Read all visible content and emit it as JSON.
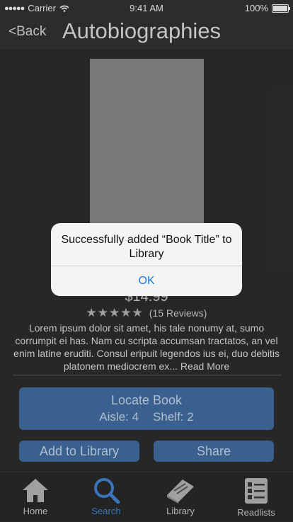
{
  "status_bar": {
    "carrier": "Carrier",
    "time": "9:41 AM",
    "battery": "100%"
  },
  "nav": {
    "back_label": "<Back",
    "title": "Autobiographies"
  },
  "book": {
    "price": "$14.99",
    "stars": "★★★★★",
    "reviews": "(15 Reviews)",
    "description": "Lorem ipsum dolor sit amet, his tale nonumy at, sumo corrumpit ei has. Nam cu scripta accumsan tractatos, an vel enim latine eruditi. Consul eripuit legendos ius ei, duo debitis platonem mediocrem ex... Read More"
  },
  "actions": {
    "locate_label": "Locate Book",
    "aisle": "Aisle: 4",
    "shelf": "Shelf: 2",
    "add_label": "Add to Library",
    "share_label": "Share"
  },
  "alert": {
    "message": "Successfully added “Book Title” to Library",
    "ok_label": "OK"
  },
  "tabs": [
    {
      "label": "Home",
      "icon": "home-icon"
    },
    {
      "label": "Search",
      "icon": "search-icon",
      "active": true
    },
    {
      "label": "Library",
      "icon": "book-icon"
    },
    {
      "label": "Readlists",
      "icon": "checklist-icon"
    }
  ],
  "colors": {
    "accent": "#3d6696",
    "active_tab": "#3d7cc4",
    "alert_link": "#1a7be0"
  }
}
